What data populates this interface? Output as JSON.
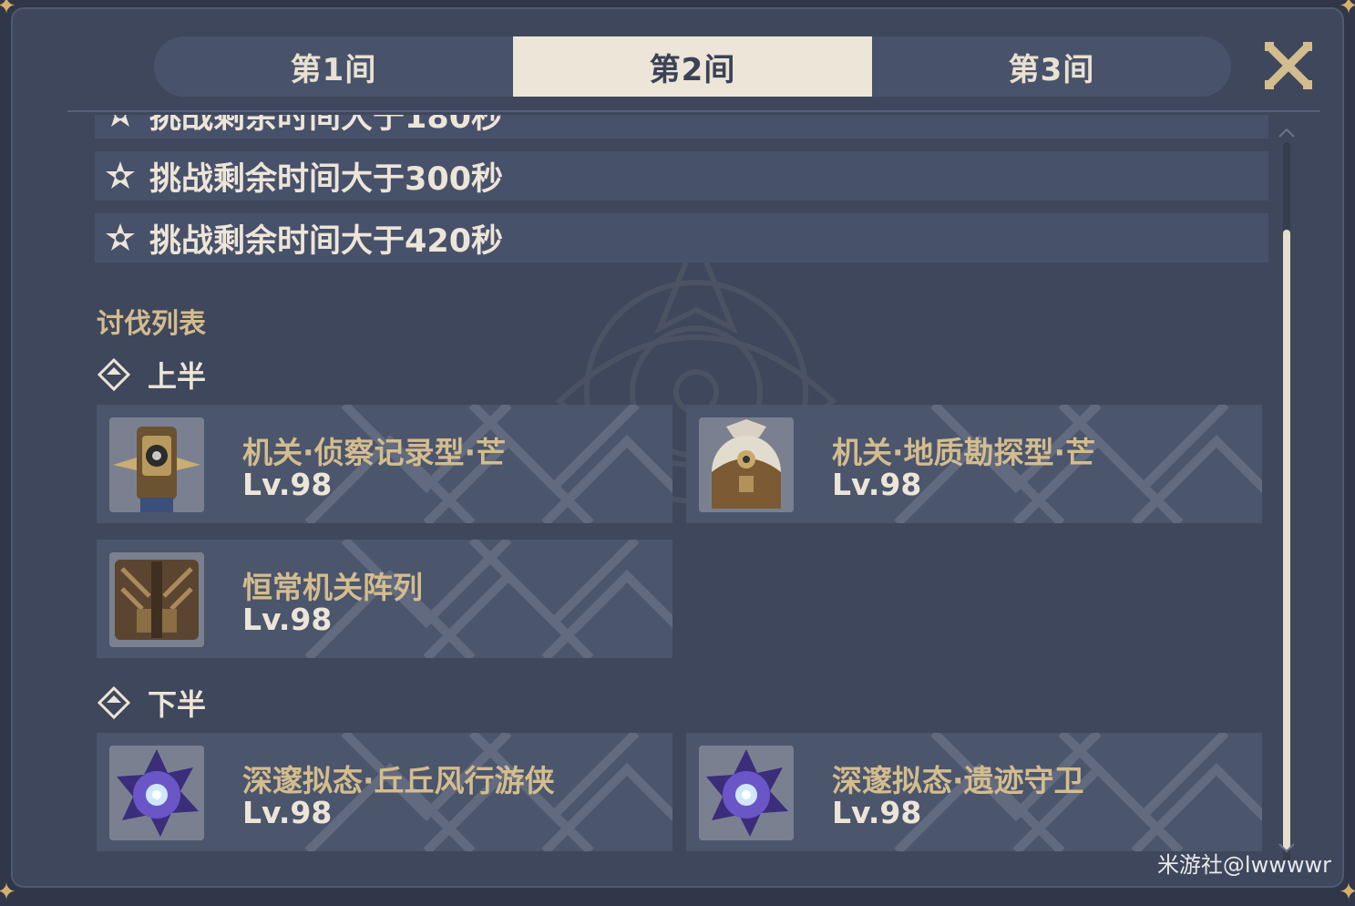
{
  "tabs": [
    {
      "label": "第1间",
      "active": false
    },
    {
      "label": "第2间",
      "active": true
    },
    {
      "label": "第3间",
      "active": false
    }
  ],
  "close_icon": "close-x-icon",
  "conditions": [
    {
      "label": "挑战剩余时间大于180秒"
    },
    {
      "label": "挑战剩余时间大于300秒"
    },
    {
      "label": "挑战剩余时间大于420秒"
    }
  ],
  "enemy_list": {
    "title": "讨伐列表",
    "upper": {
      "label": "上半",
      "enemies": [
        {
          "name": "机关·侦察记录型·芒",
          "level": "Lv.98",
          "icon": "recon-log-mek-portrait"
        },
        {
          "name": "机关·地质勘探型·芒",
          "level": "Lv.98",
          "icon": "survey-mek-portrait"
        },
        {
          "name": "恒常机关阵列",
          "level": "Lv.98",
          "icon": "perpetual-mechanical-array-portrait"
        }
      ]
    },
    "lower": {
      "label": "下半",
      "enemies": [
        {
          "name": "深邃拟态·丘丘风行游侠",
          "level": "Lv.98",
          "icon": "abyssal-mimic-portrait"
        },
        {
          "name": "深邃拟态·遗迹守卫",
          "level": "Lv.98",
          "icon": "abyssal-mimic-portrait"
        }
      ]
    }
  },
  "watermark": "米游社@lwwwwr",
  "colors": {
    "background": "#3e475b",
    "tab_active": "#ece5d8",
    "gold_text": "#d3bc8e",
    "light_text": "#ece5d8"
  }
}
